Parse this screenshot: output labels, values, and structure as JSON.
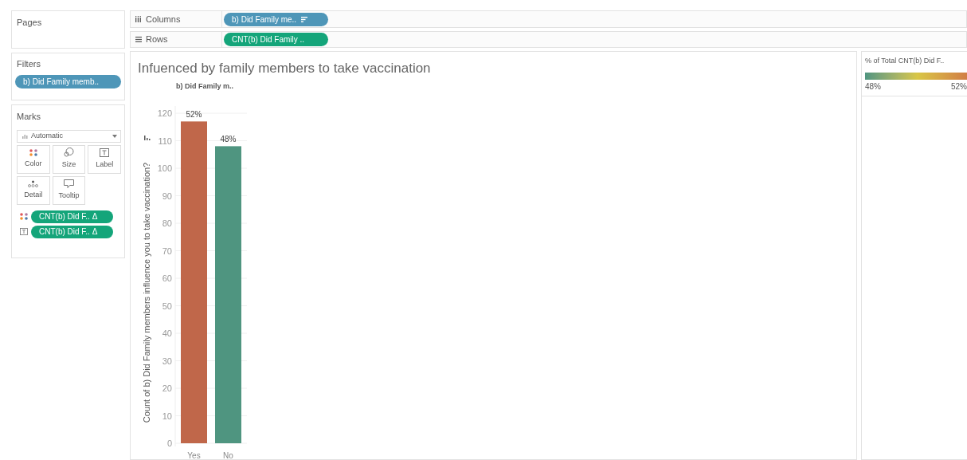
{
  "pages": {
    "title": "Pages"
  },
  "columns_shelf": {
    "label": "Columns",
    "pill": "b) Did Family me.."
  },
  "rows_shelf": {
    "label": "Rows",
    "pill": "CNT(b) Did Family .."
  },
  "filters": {
    "title": "Filters",
    "pills": [
      "b) Did Family memb.."
    ]
  },
  "marks": {
    "title": "Marks",
    "mark_type": "Automatic",
    "buttons": [
      {
        "kind": "color",
        "label": "Color"
      },
      {
        "kind": "size",
        "label": "Size"
      },
      {
        "kind": "label",
        "label": "Label"
      },
      {
        "kind": "detail",
        "label": "Detail"
      },
      {
        "kind": "tooltip",
        "label": "Tooltip"
      }
    ],
    "fields": [
      {
        "kind": "color",
        "label": "CNT(b) Did F.. Δ"
      },
      {
        "kind": "label",
        "label": "CNT(b) Did F.. Δ"
      }
    ]
  },
  "view": {
    "title": "Infuenced by family members to take vaccination",
    "column_header": "b) Did Family m..",
    "chart_data": {
      "type": "bar",
      "ylabel": "Count of b) Did Family members influence you to take vaccination?",
      "categories": [
        "Yes",
        "No"
      ],
      "series": [
        {
          "color": "#c0674a",
          "values": [
            117,
            null
          ]
        },
        {
          "color": "#4f9580",
          "values": [
            null,
            108
          ]
        }
      ],
      "grid": true,
      "stacked": true,
      "ylim": [
        0,
        120
      ],
      "yticks": [
        0,
        10,
        20,
        30,
        40,
        50,
        60,
        70,
        80,
        90,
        100,
        110,
        120
      ],
      "value_labels": [
        "52%",
        "48%"
      ]
    }
  },
  "legend": {
    "title": "% of Total CNT(b) Did F..",
    "min_label": "48%",
    "max_label": "52%"
  }
}
